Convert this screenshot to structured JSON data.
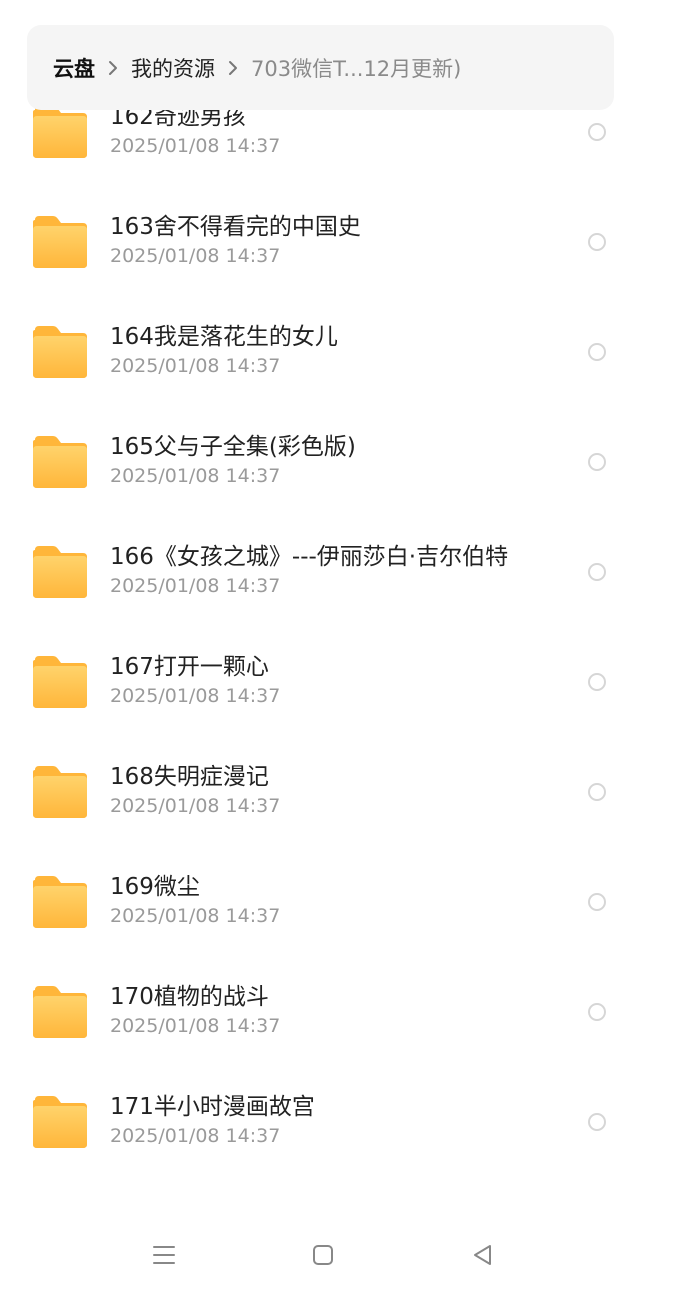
{
  "breadcrumb": {
    "root": "云盘",
    "parent": "我的资源",
    "current": "703微信T...12月更新)"
  },
  "files": [
    {
      "name": "162奇迹男孩",
      "date": "2025/01/08 14:37"
    },
    {
      "name": "163舍不得看完的中国史",
      "date": "2025/01/08 14:37"
    },
    {
      "name": "164我是落花生的女儿",
      "date": "2025/01/08 14:37"
    },
    {
      "name": "165父与子全集(彩色版)",
      "date": "2025/01/08 14:37"
    },
    {
      "name": "166《女孩之城》---伊丽莎白·吉尔伯特",
      "date": "2025/01/08 14:37"
    },
    {
      "name": "167打开一颗心",
      "date": "2025/01/08 14:37"
    },
    {
      "name": "168失明症漫记",
      "date": "2025/01/08 14:37"
    },
    {
      "name": "169微尘",
      "date": "2025/01/08 14:37"
    },
    {
      "name": "170植物的战斗",
      "date": "2025/01/08 14:37"
    },
    {
      "name": "171半小时漫画故宫",
      "date": "2025/01/08 14:37"
    }
  ],
  "icons": {
    "folder": "folder-icon",
    "separator": "chevron-right-icon",
    "select": "radio-circle-icon",
    "nav_menu": "menu-lines-icon",
    "nav_home": "square-home-icon",
    "nav_back": "triangle-back-icon"
  },
  "colors": {
    "folder_light": "#FFD36B",
    "folder_dark": "#FFB63A",
    "date_text": "#9A9A9A",
    "breadcrumb_bg": "#F5F5F5"
  }
}
